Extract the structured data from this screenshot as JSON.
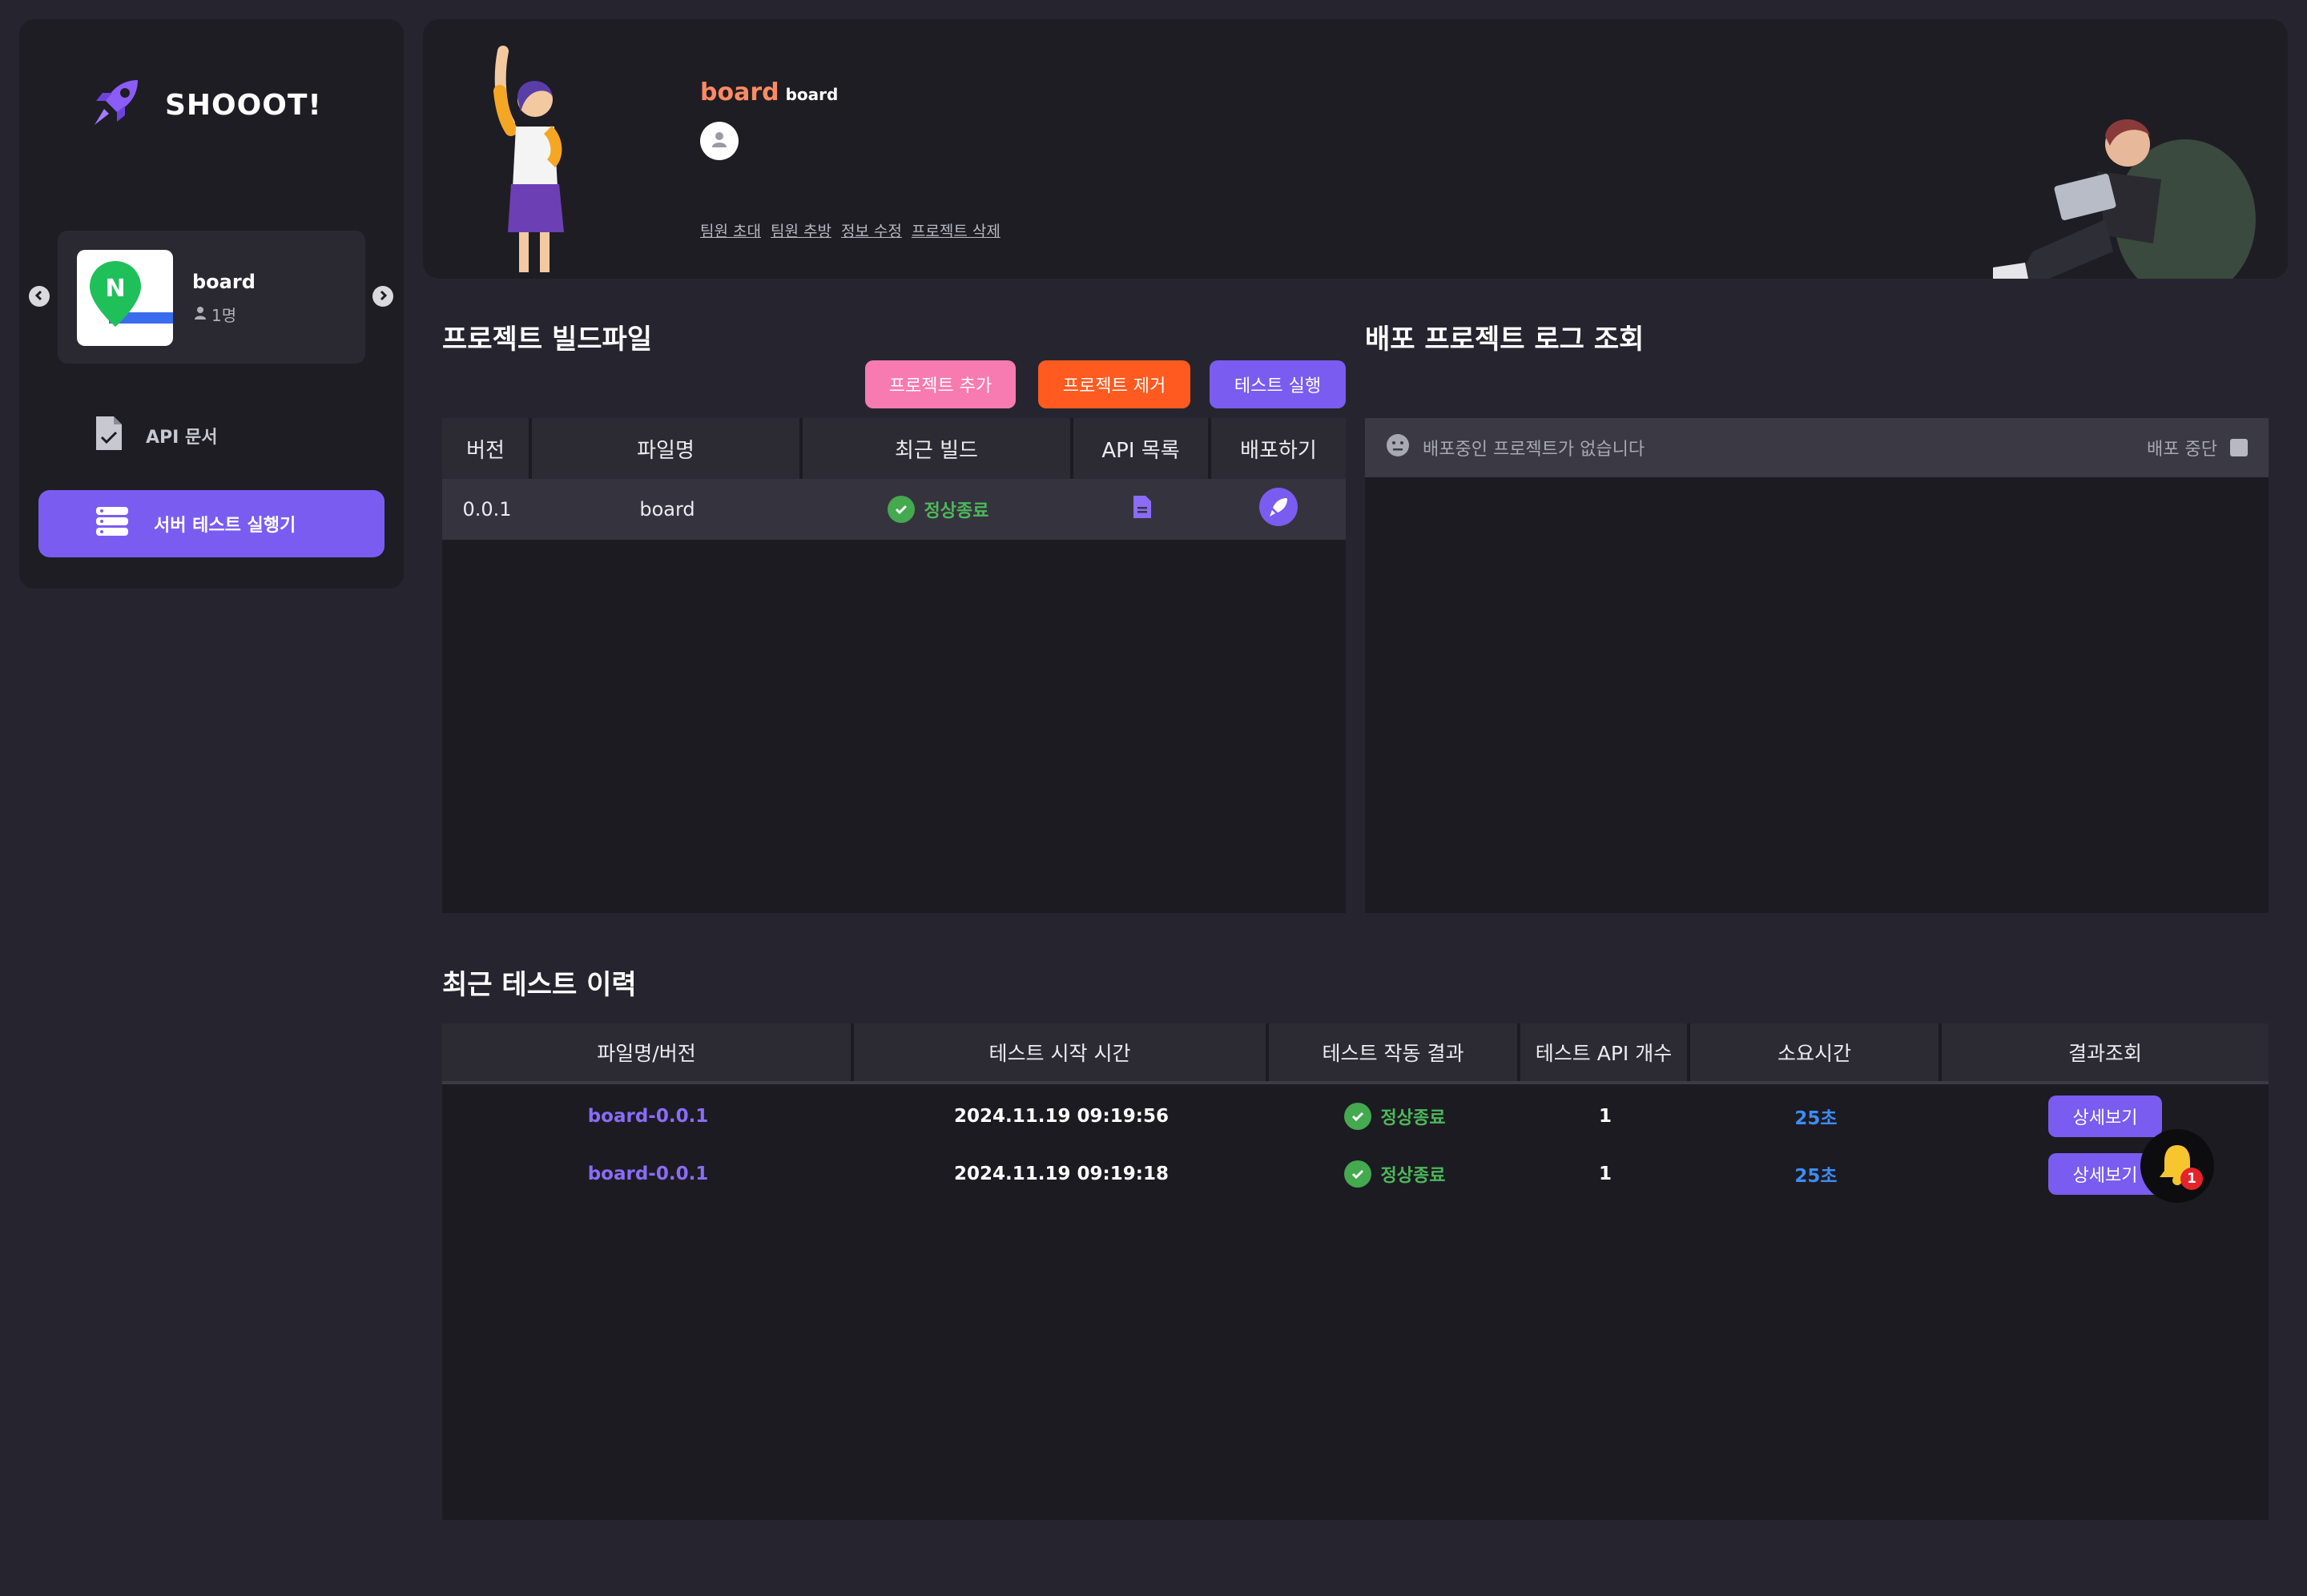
{
  "app": {
    "logo_text": "SHOOOT!"
  },
  "sidebar": {
    "project": {
      "name": "board",
      "members": "1명",
      "thumb_letter": "N"
    },
    "nav_api_docs": "API 문서",
    "nav_server_runner": "서버 테스트 실행기"
  },
  "banner": {
    "project_name": "board",
    "project_sub": "board",
    "links": [
      "팀원 초대",
      "팀원 추방",
      "정보 수정",
      "프로젝트 삭제"
    ]
  },
  "build": {
    "title": "프로젝트 빌드파일",
    "buttons": {
      "add": "프로젝트 추가",
      "remove": "프로젝트 제거",
      "test": "테스트 실행"
    },
    "headers": [
      "버전",
      "파일명",
      "최근 빌드",
      "API 목록",
      "배포하기"
    ],
    "rows": [
      {
        "version": "0.0.1",
        "file": "board",
        "status": "정상종료"
      }
    ]
  },
  "log": {
    "title": "배포 프로젝트 로그 조회",
    "empty_text": "배포중인 프로젝트가 없습니다",
    "stop_label": "배포 중단"
  },
  "history": {
    "title": "최근 테스트 이력",
    "headers": [
      "파일명/버전",
      "테스트 시작 시간",
      "테스트 작동 결과",
      "테스트 API 개수",
      "소요시간",
      "결과조회"
    ],
    "rows": [
      {
        "file": "board-0.0.1",
        "time": "2024.11.19 09:19:56",
        "result": "정상종료",
        "api_count": "1",
        "duration": "25초",
        "action": "상세보기"
      },
      {
        "file": "board-0.0.1",
        "time": "2024.11.19 09:19:18",
        "result": "정상종료",
        "api_count": "1",
        "duration": "25초",
        "action": "상세보기"
      }
    ]
  },
  "notification": {
    "count": "1"
  },
  "colors": {
    "accent": "#7b5cf0",
    "btn_add": "#f77bb0",
    "btn_remove": "#ff5a1f",
    "success": "#4cb85a",
    "duration": "#3d8cf5",
    "title_orange": "#ff8a62"
  },
  "icons": [
    "rocket-icon",
    "chevron-left-icon",
    "chevron-right-icon",
    "user-icon",
    "document-check-icon",
    "server-icon",
    "check-circle-icon",
    "file-icon",
    "neutral-face-icon",
    "bell-icon"
  ]
}
